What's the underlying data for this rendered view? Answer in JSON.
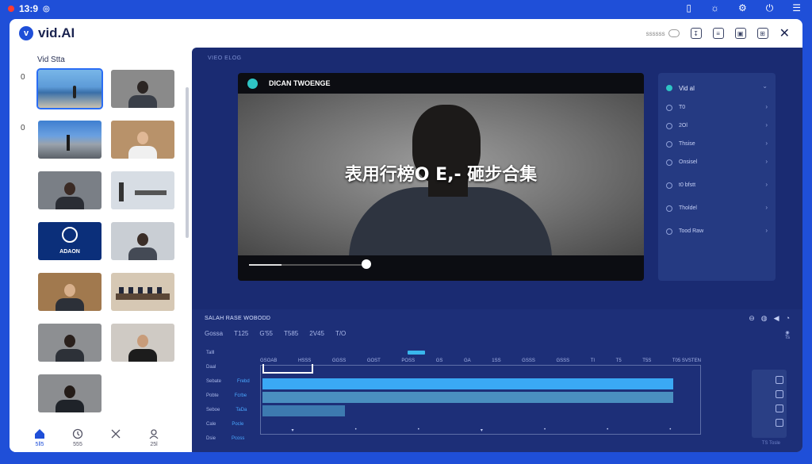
{
  "status_bar": {
    "time": "13:9"
  },
  "app": {
    "logo_letter": "v",
    "title": "vid.AI"
  },
  "sidebar": {
    "title": "Vid Stta",
    "row_markers": [
      "0",
      "0"
    ],
    "nav": [
      {
        "label": "5ll5"
      },
      {
        "label": "555"
      },
      {
        "label": ""
      },
      {
        "label": "25l"
      }
    ]
  },
  "main": {
    "label": "VIEO ELOG"
  },
  "player": {
    "title": "DICAN TWOENGE",
    "subtitle": "表用行榜O E,- 砸步合集",
    "progress": 0.28
  },
  "menu": {
    "header": "Vid al",
    "items": [
      {
        "label": "T0"
      },
      {
        "label": "2Ol"
      },
      {
        "label": "Thsise"
      },
      {
        "label": "Onsisel"
      },
      {
        "label": "t0 bfstt"
      },
      {
        "label": "Tholdel"
      },
      {
        "label": "Tood Raw"
      }
    ]
  },
  "timeline": {
    "title": "SALAH RASE WOBODD",
    "tabs": [
      "Gossa",
      "T125",
      "G'55",
      "T585",
      "2V45",
      "T/O"
    ],
    "small_label": "Ts",
    "track_labels": [
      {
        "a": "Talll",
        "b": ""
      },
      {
        "a": "Daal",
        "b": ""
      },
      {
        "a": "Sebate",
        "b": "Frebd"
      },
      {
        "a": "Pobte",
        "b": "Fcrbe"
      },
      {
        "a": "Seboe",
        "b": "TaDa"
      },
      {
        "a": "Cale",
        "b": "Pocle"
      },
      {
        "a": "Dsie",
        "b": "Pcoss"
      }
    ],
    "ruler": [
      "GSOAB",
      "HSSS",
      "GGSS",
      "GOST",
      "POSS",
      "GS",
      "GA",
      "1SS",
      "GSSS",
      "GSSS",
      "TI",
      "T5",
      "T5S",
      "T05 SVSTEN"
    ],
    "footer": "TS Tosle"
  }
}
